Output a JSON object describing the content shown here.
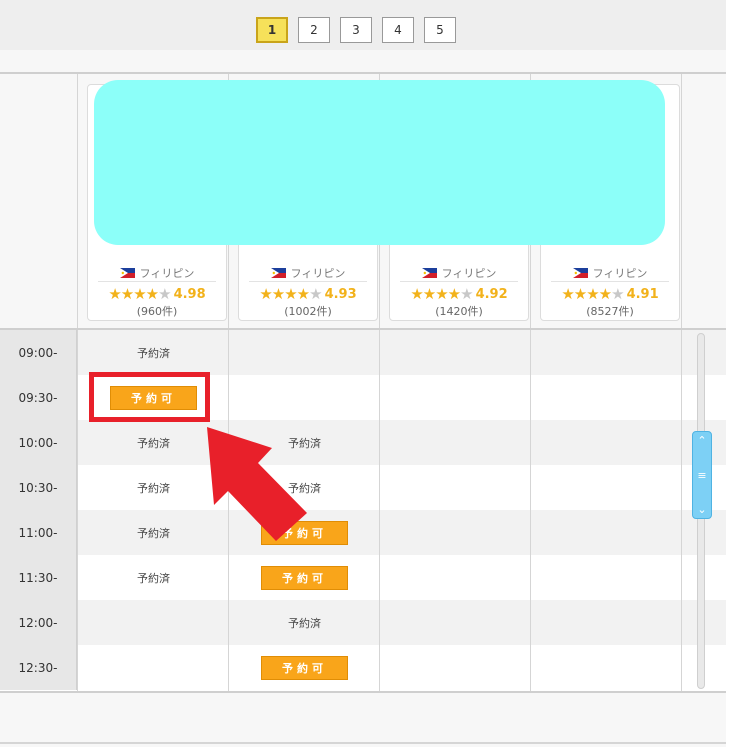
{
  "pagination": {
    "pages": [
      "1",
      "2",
      "3",
      "4",
      "5"
    ],
    "current": "1"
  },
  "teachers": [
    {
      "country": "フィリピン",
      "rating": "4.98",
      "reviews": "(960件)",
      "stars": "★★★★",
      "half_star": "★"
    },
    {
      "country": "フィリピン",
      "rating": "4.93",
      "reviews": "(1002件)",
      "stars": "★★★★",
      "half_star": "★"
    },
    {
      "country": "フィリピン",
      "rating": "4.92",
      "reviews": "(1420件)",
      "stars": "★★★★",
      "half_star": "★"
    },
    {
      "country": "フィリピン",
      "rating": "4.91",
      "reviews": "(8527件)",
      "stars": "★★★★",
      "half_star": "★"
    }
  ],
  "schedule": {
    "booked_label": "予約済",
    "available_label": "予約可",
    "rows": [
      {
        "time": "09:00-",
        "slots": [
          "booked",
          "",
          "",
          ""
        ]
      },
      {
        "time": "09:30-",
        "slots": [
          "available",
          "",
          "",
          ""
        ]
      },
      {
        "time": "10:00-",
        "slots": [
          "booked",
          "booked",
          "",
          ""
        ]
      },
      {
        "time": "10:30-",
        "slots": [
          "booked",
          "booked",
          "",
          ""
        ]
      },
      {
        "time": "11:00-",
        "slots": [
          "booked",
          "available",
          "",
          ""
        ]
      },
      {
        "time": "11:30-",
        "slots": [
          "booked",
          "available",
          "",
          ""
        ]
      },
      {
        "time": "12:00-",
        "slots": [
          "",
          "booked",
          "",
          ""
        ]
      },
      {
        "time": "12:30-",
        "slots": [
          "",
          "available",
          "",
          ""
        ]
      }
    ]
  },
  "scrollbar": {
    "up_icon": "chevron-up-icon",
    "grip_icon": "menu-grip-icon",
    "down_icon": "chevron-down-icon"
  },
  "colors": {
    "accent_button": "#f9a51a",
    "annotation_red": "#e8202a",
    "photo_mask": "#8cfff9",
    "star": "#f2b21b",
    "scroll_thumb": "#7dd0f5"
  }
}
